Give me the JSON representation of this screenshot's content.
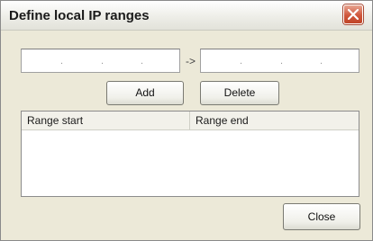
{
  "window": {
    "title": "Define local IP ranges",
    "close_icon": "close-x-icon"
  },
  "range_inputs": {
    "start_ip_value": "",
    "end_ip_value": "",
    "separator_symbol": "->",
    "octet_dot": "."
  },
  "buttons": {
    "add_label": "Add",
    "delete_label": "Delete",
    "close_label": "Close"
  },
  "range_list": {
    "columns": [
      "Range start",
      "Range end"
    ],
    "rows": []
  },
  "colors": {
    "dialog_bg": "#ece9d8",
    "close_button": "#d0573c"
  }
}
